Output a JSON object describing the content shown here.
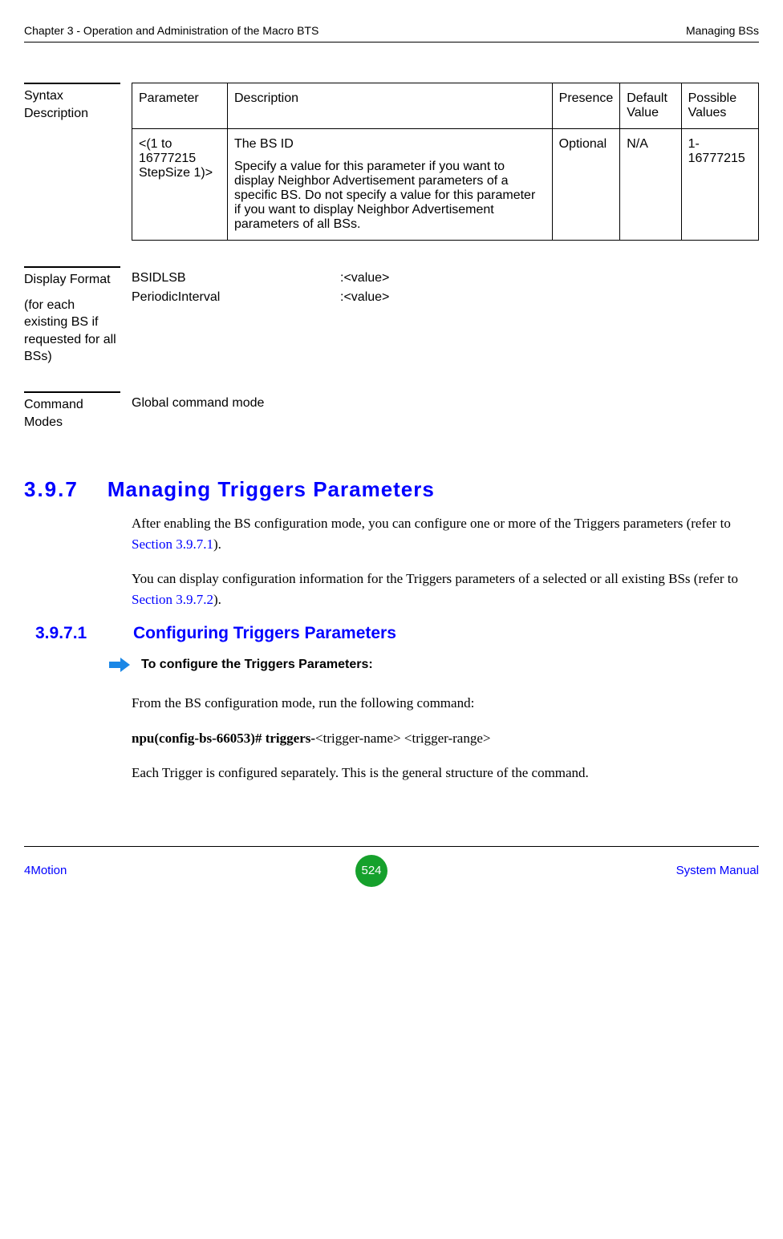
{
  "header": {
    "left": "Chapter 3 - Operation and Administration of the Macro BTS",
    "right": "Managing BSs"
  },
  "syntax": {
    "label": "Syntax Description",
    "columns": {
      "param": "Parameter",
      "desc": "Description",
      "presence": "Presence",
      "default": "Default Value",
      "possible": "Possible Values"
    },
    "row": {
      "param": "<(1 to 16777215 StepSize 1)>",
      "desc_line1": "The BS ID",
      "desc_line2": "Specify a value for this parameter if you want to display Neighbor Advertisement parameters of a specific BS. Do not specify a value for this parameter if you want to display Neighbor Advertisement parameters of all BSs.",
      "presence": "Optional",
      "default": "N/A",
      "possible": "1-16777215"
    }
  },
  "display": {
    "label": "Display Format",
    "sublabel": "(for each existing BS if requested for all BSs)",
    "kv1_label": "BSIDLSB",
    "kv1_val": ":<value>",
    "kv2_label": "PeriodicInterval",
    "kv2_val": ":<value>"
  },
  "command": {
    "label": "Command Modes",
    "value": "Global command mode"
  },
  "section397": {
    "num": "3.9.7",
    "title": "Managing Triggers Parameters",
    "para1_a": "After enabling the BS configuration mode, you can configure one or more of the Triggers parameters (refer to ",
    "para1_link": "Section 3.9.7.1",
    "para1_b": ").",
    "para2_a": "You can display configuration information for the Triggers parameters of a selected or all existing BSs (refer to ",
    "para2_link": "Section 3.9.7.2",
    "para2_b": ")."
  },
  "section3971": {
    "num": "3.9.7.1",
    "title": "Configuring Triggers Parameters",
    "to_config": "To configure the Triggers Parameters:",
    "p1": "From the BS configuration mode, run the following command:",
    "cmd_bold": "npu(config-bs-66053)# triggers-",
    "cmd_rest": "<trigger-name> <trigger-range>",
    "p2": "Each Trigger is configured separately. This is the general structure of the command."
  },
  "footer": {
    "left": "4Motion",
    "page": "524",
    "right": "System Manual"
  }
}
